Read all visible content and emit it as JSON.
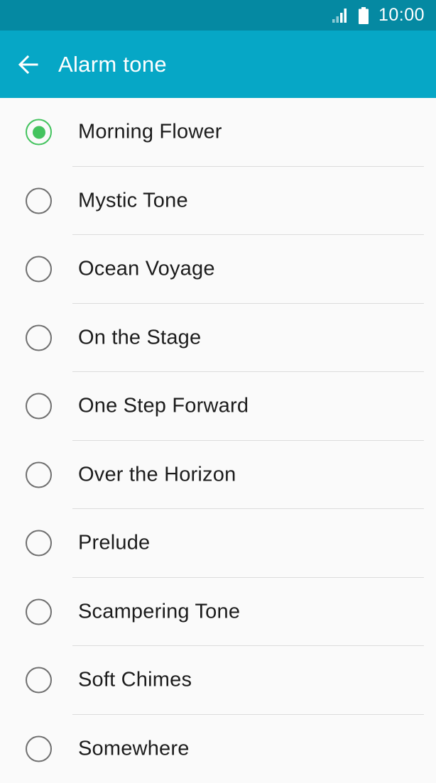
{
  "status_bar": {
    "time": "10:00",
    "signal_icon": "cell-signal-icon",
    "battery_icon": "battery-icon"
  },
  "app_bar": {
    "title": "Alarm tone",
    "back_icon": "arrow-left-icon"
  },
  "tones": [
    {
      "label": "Morning Flower",
      "selected": true
    },
    {
      "label": "Mystic Tone",
      "selected": false
    },
    {
      "label": "Ocean Voyage",
      "selected": false
    },
    {
      "label": "On the Stage",
      "selected": false
    },
    {
      "label": "One Step Forward",
      "selected": false
    },
    {
      "label": "Over the Horizon",
      "selected": false
    },
    {
      "label": "Prelude",
      "selected": false
    },
    {
      "label": "Scampering Tone",
      "selected": false
    },
    {
      "label": "Soft Chimes",
      "selected": false
    },
    {
      "label": "Somewhere",
      "selected": false
    }
  ],
  "colors": {
    "status_bar": "#0589a2",
    "app_bar": "#06a7c6",
    "accent": "#43c35e",
    "radio_off": "#6f6f6f"
  }
}
